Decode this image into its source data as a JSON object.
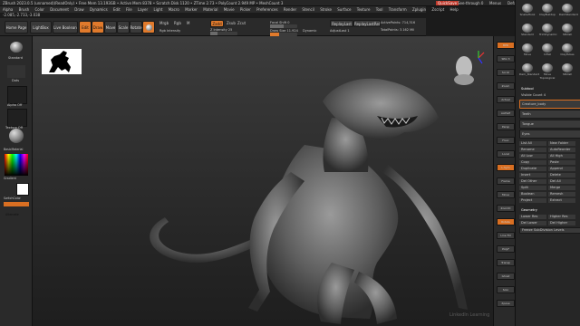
{
  "window": {
    "title": "ZBrush 2023.0.5 (unnamed)(ReadOnly) • Free Mem 13.193GB • Active Mem 8378 • Scratch Disk 1120 • ZTime 2.73 • PolyCount 2.949 MP • MeshCount 3",
    "right_buttons": [
      "QuickSave",
      "See-through 0",
      "Menus",
      "DefaultZScript"
    ]
  },
  "menu": [
    "Alpha",
    "Brush",
    "Color",
    "Document",
    "Draw",
    "Dynamics",
    "Edit",
    "File",
    "Layer",
    "Light",
    "Macro",
    "Marker",
    "Material",
    "Movie",
    "Picker",
    "Preferences",
    "Render",
    "Stencil",
    "Stroke",
    "Surface",
    "Texture",
    "Tool",
    "Transform",
    "Zplugin",
    "Zscript",
    "Help"
  ],
  "coords": "-2.085,-2.733,-3.038",
  "toolbar": {
    "home_page": "Home Page",
    "lightbox": "LightBox",
    "live_boolean": "Live Boolean",
    "edit": "Edit",
    "draw": "Draw",
    "move": "Move",
    "scale": "Scale",
    "rotate": "Rotate",
    "mrgb": "Mrgb",
    "rgb": "Rgb",
    "m": "M",
    "zadd": "Zadd",
    "zsub": "Zsub",
    "zcut": "Zcut",
    "rgb_intensity": "Rgb Intensity",
    "z_intensity": "Z Intensity 25",
    "z_intensity_value": 0.25,
    "focal_shift": "Focal Shift 0",
    "draw_size": "Draw Size 11.924",
    "dynamic": "Dynamic",
    "replay_last": "ReplayLast",
    "replay_last_rel": "ReplayLastRel",
    "active_points": "ActivePoints: 714,316",
    "total_points": "TotalPoints: 3.162 Mil",
    "adjust_last": "AdjustLast 1"
  },
  "left_shelf": {
    "standard": "Standard",
    "dots": "Dots",
    "alpha_off": "Alpha Off",
    "texture_off": "Texture Off",
    "material": "BasicMaterial",
    "gradient": "Gradient",
    "switch_color": "SwitchColor",
    "alternate": "Alternate"
  },
  "right_shelf": [
    "BPR",
    "SPix 3",
    "Scroll",
    "Zoom",
    "Actual",
    "AAHalf",
    "Persp",
    "Floor",
    "Local",
    "L.Sym",
    "Frame",
    "Move",
    "ZoomD",
    "Rotate",
    "Line Fill",
    "PolyF",
    "Transp",
    "Ghost",
    "Solo",
    "Xpose"
  ],
  "right_menu": {
    "brushes": [
      "SnakeHook",
      "ClayBuildup",
      "DamStandard",
      "Standard",
      "TrimDynamic",
      "hPolish",
      "Move",
      "Inflat",
      "ClayTubes",
      "Dam_Standard",
      "Move Topological",
      "hPolish"
    ],
    "subtool_header": "Subtool",
    "visible_count": "Visible Count 4",
    "subtools": [
      "Creature_body",
      "Teeth",
      "Tongue",
      "Eyes"
    ],
    "buttons": [
      "List All",
      "New Folder",
      "Rename",
      "AutoReorder",
      "All Low",
      "All High",
      "Copy",
      "Paste",
      "Duplicate",
      "Append",
      "Insert",
      "Delete",
      "Del Other",
      "Del All",
      "Split",
      "Merge",
      "Boolean",
      "Remesh",
      "Project",
      "Extract"
    ],
    "geometry_header": "Geometry",
    "lower_res": "Lower Res",
    "higher_res": "Higher Res",
    "sdiv": "SDiv",
    "del_lower": "Del Lower",
    "del_higher": "Del Higher",
    "freeze_subdivision_levels": "Freeze SubDivision Levels"
  },
  "colors": {
    "accent_orange": "#e07a2c",
    "canvas_top": "#3c3c3c",
    "canvas_bottom": "#1e1e1e"
  },
  "watermark": "LinkedIn Learning"
}
